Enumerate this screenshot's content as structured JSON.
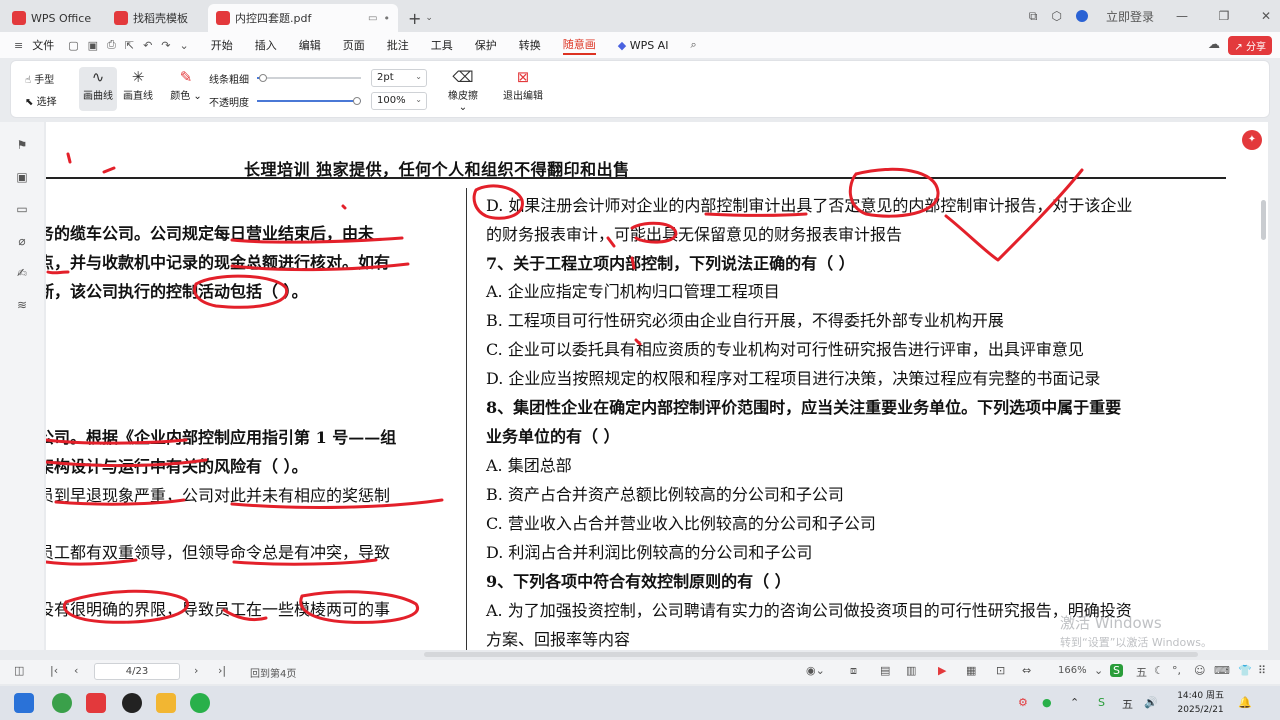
{
  "tabs": [
    {
      "label": "WPS Office",
      "color": "#e3393c"
    },
    {
      "label": "找稻壳模板",
      "color": "#e3393c"
    },
    {
      "label": "内控四套题.pdf",
      "color": "#e3393c",
      "active": true
    }
  ],
  "header_right": {
    "login": "立即登录"
  },
  "menubar": {
    "file": "文件",
    "items": [
      "开始",
      "插入",
      "编辑",
      "页面",
      "批注",
      "工具",
      "保护",
      "转换",
      "随意画",
      "WPS AI"
    ],
    "active_item": "随意画",
    "share": "分享"
  },
  "ribbon": {
    "hand": "手型",
    "select": "选择",
    "curve": "画曲线",
    "line": "画直线",
    "color": "颜色",
    "thickness_label": "线条粗细",
    "thickness_value": "2pt",
    "opacity_label": "不透明度",
    "opacity_value": "100%",
    "eraser": "橡皮擦",
    "exit": "退出编辑"
  },
  "document": {
    "header": "长理培训   独家提供，任何个人和组织不得翻印和出售",
    "left_lines": [
      {
        "text": "务的缆车公司。公司规定每日营业结束后，由未",
        "bold": true
      },
      {
        "text": "点，并与收款机中记录的现金总额进行核对。如有",
        "bold": true
      },
      {
        "text": "断，该公司执行的控制活动包括（      ）。",
        "bold": true
      },
      {
        "text": "公司。根据《企业内部控制应用指引第 1 号——组",
        "bold": true
      },
      {
        "text": "架构设计与运行中有关的风险有（      ）。",
        "bold": true
      },
      {
        "text": "员到早退现象严重，公司对此并未有相应的奖惩制",
        "bold": false
      },
      {
        "text": "员工都有双重领导，但领导命令总是有冲突，导致",
        "bold": false
      },
      {
        "text": "没有很明确的界限，导致员工在一些模棱两可的事",
        "bold": false
      }
    ],
    "right_lines": [
      {
        "text": "D. 如果注册会计师对企业的内部控制审计出具了否定意见的内部控制审计报告，对于该企业",
        "bold": false
      },
      {
        "text": "的财务报表审计，可能出具无保留意见的财务报表审计报告",
        "bold": false
      },
      {
        "text": "7、关于工程立项内部控制，下列说法正确的有（        ）",
        "bold": true
      },
      {
        "text": "A. 企业应指定专门机构归口管理工程项目",
        "bold": false
      },
      {
        "text": "B. 工程项目可行性研究必须由企业自行开展，不得委托外部专业机构开展",
        "bold": false
      },
      {
        "text": "C. 企业可以委托具有相应资质的专业机构对可行性研究报告进行评审，出具评审意见",
        "bold": false
      },
      {
        "text": "D. 企业应当按照规定的权限和程序对工程项目进行决策，决策过程应有完整的书面记录",
        "bold": false
      },
      {
        "text": "8、集团性企业在确定内部控制评价范围时，应当关注重要业务单位。下列选项中属于重要",
        "bold": true
      },
      {
        "text": "业务单位的有（        ）",
        "bold": true
      },
      {
        "text": "A. 集团总部",
        "bold": false
      },
      {
        "text": "B. 资产占合并资产总额比例较高的分公司和子公司",
        "bold": false
      },
      {
        "text": "C. 营业收入占合并营业收入比例较高的分公司和子公司",
        "bold": false
      },
      {
        "text": "D. 利润占合并利润比例较高的分公司和子公司",
        "bold": false
      },
      {
        "text": "9、下列各项中符合有效控制原则的有（        ）",
        "bold": true
      },
      {
        "text": "A. 为了加强投资控制，公司聘请有实力的咨询公司做投资项目的可行性研究报告，明确投资",
        "bold": false
      },
      {
        "text": "方案、回报率等内容",
        "bold": false
      }
    ],
    "watermark_title": "激活 Windows",
    "watermark_sub": "转到“设置”以激活 Windows。"
  },
  "statusbar": {
    "page": "4/23",
    "back": "回到第4页",
    "zoom": "166%"
  },
  "taskbar": {
    "ime": "五",
    "time": "14:40 周五",
    "date": "2025/2/21"
  },
  "accent_color": "#e3393c"
}
